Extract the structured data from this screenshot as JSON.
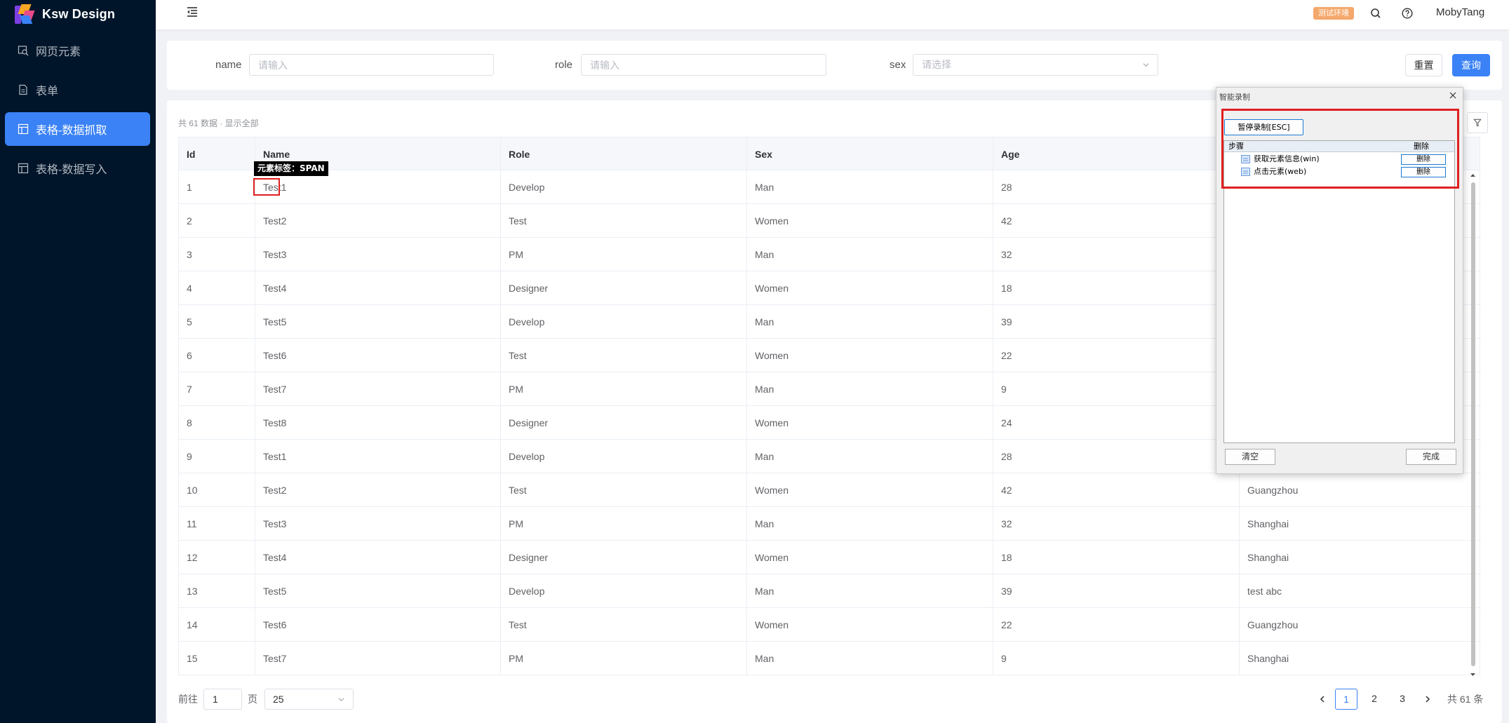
{
  "app": {
    "logo_text": "Ksw Design"
  },
  "sidebar": {
    "items": [
      {
        "label": "网页元素",
        "icon": "web-inspect-icon",
        "active": false
      },
      {
        "label": "表单",
        "icon": "document-icon",
        "active": false
      },
      {
        "label": "表格-数据抓取",
        "icon": "table-icon",
        "active": true
      },
      {
        "label": "表格-数据写入",
        "icon": "table-icon",
        "active": false
      }
    ]
  },
  "header": {
    "env_badge": "测试环境",
    "username": "MobyTang",
    "colors": {
      "env_badge": "#f5a86c"
    }
  },
  "search": {
    "name_label": "name",
    "name_placeholder": "请输入",
    "role_label": "role",
    "role_placeholder": "请输入",
    "sex_label": "sex",
    "sex_placeholder": "请选择",
    "reset_label": "重置",
    "query_label": "查询"
  },
  "table": {
    "info": "共 61 数据 · 显示全部",
    "columns": [
      "Id",
      "Name",
      "Role",
      "Sex",
      "Age",
      ""
    ],
    "rows": [
      [
        "1",
        "Test1",
        "Develop",
        "Man",
        "28",
        ""
      ],
      [
        "2",
        "Test2",
        "Test",
        "Women",
        "42",
        ""
      ],
      [
        "3",
        "Test3",
        "PM",
        "Man",
        "32",
        ""
      ],
      [
        "4",
        "Test4",
        "Designer",
        "Women",
        "18",
        ""
      ],
      [
        "5",
        "Test5",
        "Develop",
        "Man",
        "39",
        ""
      ],
      [
        "6",
        "Test6",
        "Test",
        "Women",
        "22",
        ""
      ],
      [
        "7",
        "Test7",
        "PM",
        "Man",
        "9",
        ""
      ],
      [
        "8",
        "Test8",
        "Designer",
        "Women",
        "24",
        ""
      ],
      [
        "9",
        "Test1",
        "Develop",
        "Man",
        "28",
        ""
      ],
      [
        "10",
        "Test2",
        "Test",
        "Women",
        "42",
        "Guangzhou"
      ],
      [
        "11",
        "Test3",
        "PM",
        "Man",
        "32",
        "Shanghai"
      ],
      [
        "12",
        "Test4",
        "Designer",
        "Women",
        "18",
        "Shanghai"
      ],
      [
        "13",
        "Test5",
        "Develop",
        "Man",
        "39",
        "test abc"
      ],
      [
        "14",
        "Test6",
        "Test",
        "Women",
        "22",
        "Guangzhou"
      ],
      [
        "15",
        "Test7",
        "PM",
        "Man",
        "9",
        "Shanghai"
      ]
    ]
  },
  "pagination": {
    "goto_label": "前往",
    "goto_value": "1",
    "page_unit": "页",
    "page_size": "25",
    "pages": [
      "1",
      "2",
      "3"
    ],
    "current_page": "1",
    "total": "共 61 条"
  },
  "inspector": {
    "tooltip": "元素标签：SPAN"
  },
  "recorder": {
    "title": "智能录制",
    "pause_label": "暂停录制[ESC]",
    "col_steps": "步骤",
    "col_delete": "删除",
    "steps": [
      {
        "label": "获取元素信息(win)",
        "delete_label": "删除"
      },
      {
        "label": "点击元素(web)",
        "delete_label": "删除"
      }
    ],
    "clear_label": "清空",
    "done_label": "完成"
  }
}
